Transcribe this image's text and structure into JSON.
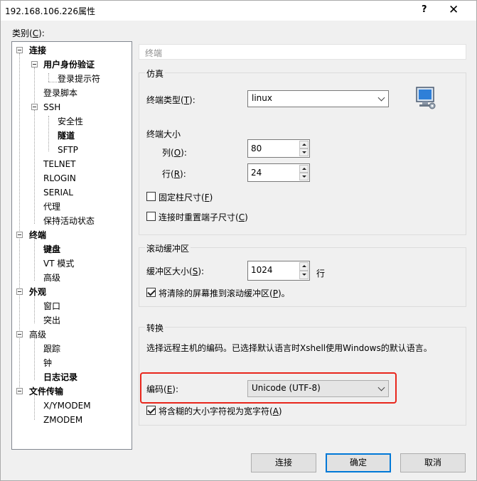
{
  "window": {
    "title": "192.168.106.226属性",
    "help": "?",
    "close": "✕"
  },
  "category_label": {
    "text": "类别(",
    "key": "C",
    "suffix": "):"
  },
  "tree": {
    "items": [
      {
        "label": "连接",
        "bold": true
      },
      {
        "label": "用户身份验证",
        "bold": true
      },
      {
        "label": "登录提示符",
        "bold": false
      },
      {
        "label": "登录脚本",
        "bold": false
      },
      {
        "label": "SSH",
        "bold": false
      },
      {
        "label": "安全性",
        "bold": false
      },
      {
        "label": "隧道",
        "bold": true
      },
      {
        "label": "SFTP",
        "bold": false
      },
      {
        "label": "TELNET",
        "bold": false
      },
      {
        "label": "RLOGIN",
        "bold": false
      },
      {
        "label": "SERIAL",
        "bold": false
      },
      {
        "label": "代理",
        "bold": false
      },
      {
        "label": "保持活动状态",
        "bold": false
      },
      {
        "label": "终端",
        "bold": true
      },
      {
        "label": "键盘",
        "bold": true
      },
      {
        "label": "VT 模式",
        "bold": false
      },
      {
        "label": "高级",
        "bold": false
      },
      {
        "label": "外观",
        "bold": true
      },
      {
        "label": "窗口",
        "bold": false
      },
      {
        "label": "突出",
        "bold": false
      },
      {
        "label": "高级",
        "bold": false
      },
      {
        "label": "跟踪",
        "bold": false
      },
      {
        "label": "钟",
        "bold": false
      },
      {
        "label": "日志记录",
        "bold": true
      },
      {
        "label": "文件传输",
        "bold": true
      },
      {
        "label": "X/YMODEM",
        "bold": false
      },
      {
        "label": "ZMODEM",
        "bold": false
      }
    ]
  },
  "section_header": "终端",
  "emulation": {
    "group_title": "仿真",
    "terminal_type_label": "终端类型(",
    "terminal_type_key": "T",
    "terminal_type_suffix": "):",
    "terminal_type_value": "linux",
    "terminal_size_label": "终端大小",
    "cols_label": "列(",
    "cols_key": "O",
    "cols_suffix": "):",
    "cols_value": "80",
    "rows_label": "行(",
    "rows_key": "R",
    "rows_suffix": "):",
    "rows_value": "24",
    "fixed_size_label": "固定柱尺寸(",
    "fixed_size_key": "F",
    "fixed_size_suffix": ")",
    "fixed_size_checked": false,
    "reset_size_label": "连接时重置端子尺寸(",
    "reset_size_key": "C",
    "reset_size_suffix": ")",
    "reset_size_checked": false
  },
  "scrollback": {
    "group_title": "滚动缓冲区",
    "buffer_label": "缓冲区大小(",
    "buffer_key": "S",
    "buffer_suffix": "):",
    "buffer_value": "1024",
    "buffer_unit": "行",
    "push_label": "将清除的屏幕推到滚动缓冲区(",
    "push_key": "P",
    "push_suffix": ")。",
    "push_checked": true
  },
  "translation": {
    "group_title": "转换",
    "description": "选择远程主机的编码。已选择默认语言时Xshell使用Windows的默认语言。",
    "encoding_label": "编码(",
    "encoding_key": "E",
    "encoding_suffix": "):",
    "encoding_value": "Unicode (UTF-8)",
    "wide_label": "将含糊的大小字符视为宽字符(",
    "wide_key": "A",
    "wide_suffix": ")",
    "wide_checked": true
  },
  "buttons": {
    "connect": "连接",
    "ok": "确定",
    "cancel": "取消"
  },
  "colors": {
    "highlight_border": "#e8261c",
    "default_button_border": "#0078d7"
  }
}
